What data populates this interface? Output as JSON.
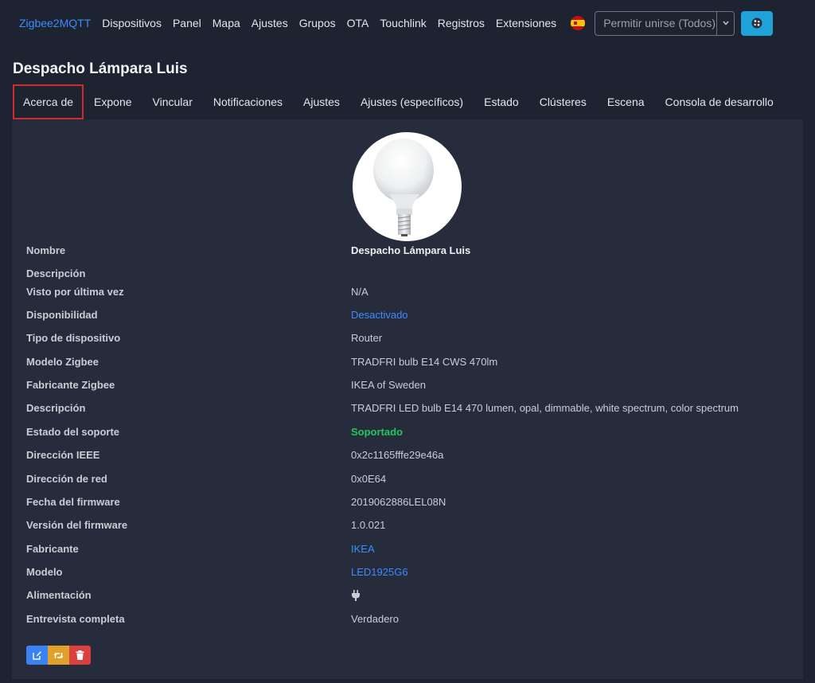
{
  "nav": {
    "brand": "Zigbee2MQTT",
    "links": [
      "Dispositivos",
      "Panel",
      "Mapa",
      "Ajustes",
      "Grupos",
      "OTA",
      "Touchlink",
      "Registros",
      "Extensiones"
    ],
    "flag_icon": "spain-flag-icon",
    "permit_join": "Permitir unirse (Todos)",
    "theme_icon": "theme-toggle-icon"
  },
  "page": {
    "title": "Despacho Lámpara Luis"
  },
  "tabs": [
    "Acerca de",
    "Expone",
    "Vincular",
    "Notificaciones",
    "Ajustes",
    "Ajustes (específicos)",
    "Estado",
    "Clústeres",
    "Escena",
    "Consola de desarrollo"
  ],
  "active_tab": "Acerca de",
  "device": {
    "image_icon": "bulb-image",
    "rows": [
      {
        "label": "Nombre",
        "value": "Despacho Lámpara Luis"
      },
      {
        "label": "Descripción",
        "value": ""
      },
      {
        "label": "Visto por última vez",
        "value": "N/A"
      },
      {
        "label": "Disponibilidad",
        "value": "Desactivado"
      },
      {
        "label": "Tipo de dispositivo",
        "value": "Router"
      },
      {
        "label": "Modelo Zigbee",
        "value": "TRADFRI bulb E14 CWS 470lm"
      },
      {
        "label": "Fabricante Zigbee",
        "value": "IKEA of Sweden"
      },
      {
        "label": "Descripción",
        "value": "TRADFRI LED bulb E14 470 lumen, opal, dimmable, white spectrum, color spectrum"
      },
      {
        "label": "Estado del soporte",
        "value": "Soportado"
      },
      {
        "label": "Dirección IEEE",
        "value": "0x2c1165fffe29e46a"
      },
      {
        "label": "Dirección de red",
        "value": "0x0E64"
      },
      {
        "label": "Fecha del firmware",
        "value": "2019062886LEL08N"
      },
      {
        "label": "Versión del firmware",
        "value": "1.0.021"
      },
      {
        "label": "Fabricante",
        "value": "IKEA"
      },
      {
        "label": "Modelo",
        "value": "LED1925G6"
      },
      {
        "label": "Alimentación",
        "value": ""
      },
      {
        "label": "Entrevista completa",
        "value": "Verdadero"
      }
    ],
    "power_icon": "plug-icon"
  },
  "actions": {
    "edit_icon": "edit-icon",
    "rename_icon": "retweet-icon",
    "delete_icon": "trash-icon"
  },
  "colors": {
    "accent": "#3d8bfd",
    "success": "#22c55e",
    "danger": "#dc3f3f",
    "warning": "#e0a02a",
    "card": "#272c3d",
    "bg": "#1e2331"
  }
}
